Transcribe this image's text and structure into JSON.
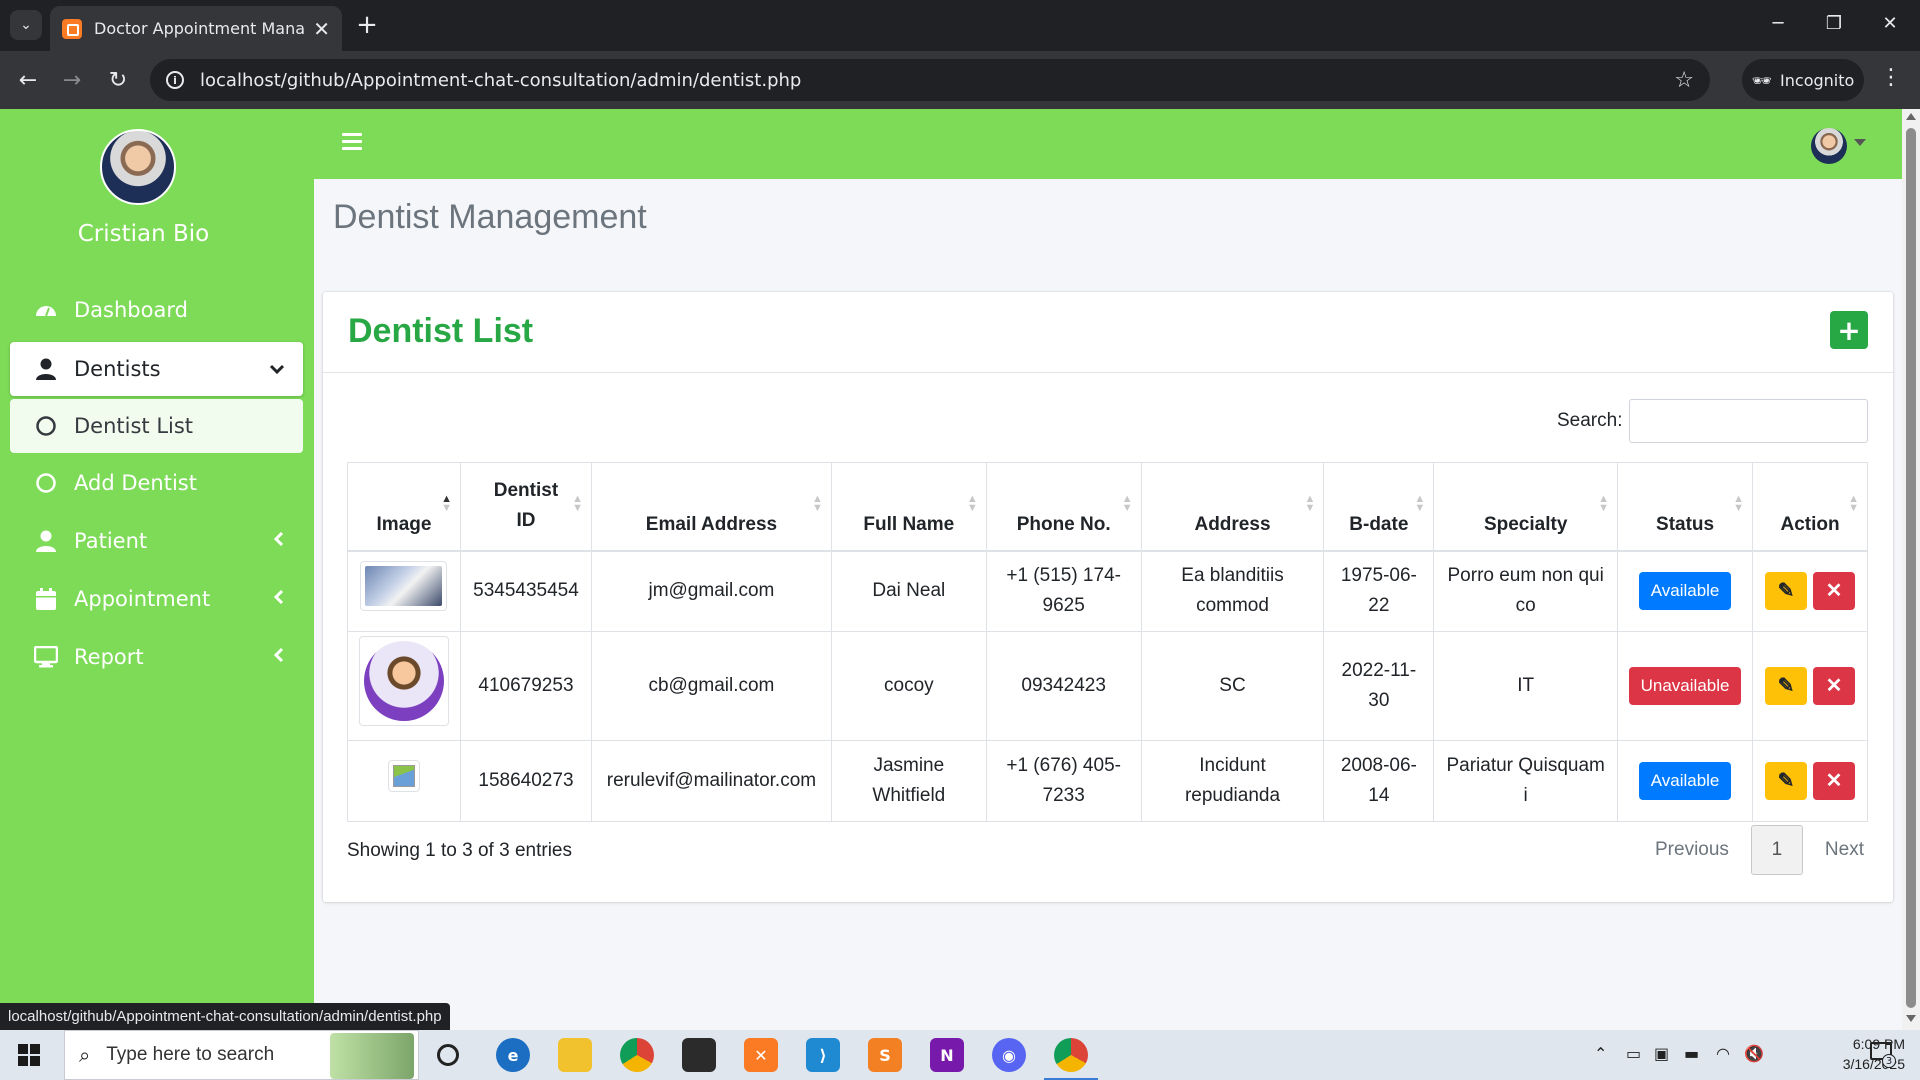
{
  "browser": {
    "tab_title": "Doctor Appointment Managem",
    "url": "localhost/github/Appointment-chat-consultation/admin/dentist.php",
    "incognito_label": "Incognito",
    "status_url": "localhost/github/Appointment-chat-consultation/admin/dentist.php"
  },
  "sidebar": {
    "user_name": "Cristian Bio",
    "items": [
      {
        "label": "Dashboard",
        "icon": "dashboard-icon"
      },
      {
        "label": "Dentists",
        "icon": "user-icon"
      },
      {
        "label": "Dentist List",
        "icon": "circle-icon"
      },
      {
        "label": "Add Dentist",
        "icon": "circle-icon"
      },
      {
        "label": "Patient",
        "icon": "user-icon"
      },
      {
        "label": "Appointment",
        "icon": "calendar-icon"
      },
      {
        "label": "Report",
        "icon": "monitor-icon"
      }
    ]
  },
  "page": {
    "title": "Dentist Management",
    "card_title": "Dentist List",
    "search_label": "Search:",
    "showing": "Showing 1 to 3 of 3 entries",
    "pager": {
      "previous": "Previous",
      "current": "1",
      "next": "Next"
    }
  },
  "table": {
    "headers": [
      "Image",
      "Dentist ID",
      "Email Address",
      "Full Name",
      "Phone No.",
      "Address",
      "B-date",
      "Specialty",
      "Status",
      "Action"
    ],
    "rows": [
      {
        "image": "photo-thumbnail",
        "id": "5345435454",
        "email": "jm@gmail.com",
        "name": "Dai Neal",
        "phone": "+1 (515) 174-9625",
        "address": "Ea blanditiis commod",
        "bdate": "1975-06-22",
        "specialty": "Porro eum non qui co",
        "status": "Available"
      },
      {
        "image": "avatar-thumbnail",
        "id": "410679253",
        "email": "cb@gmail.com",
        "name": "cocoy",
        "phone": "09342423",
        "address": "SC",
        "bdate": "2022-11-30",
        "specialty": "IT",
        "status": "Unavailable"
      },
      {
        "image": "broken-image",
        "id": "158640273",
        "email": "rerulevif@mailinator.com",
        "name": "Jasmine Whitfield",
        "phone": "+1 (676) 405-7233",
        "address": "Incidunt repudianda",
        "bdate": "2008-06-14",
        "specialty": "Pariatur Quisquam i",
        "status": "Available"
      }
    ]
  },
  "taskbar": {
    "search_placeholder": "Type here to search",
    "time": "6:09 PM",
    "date": "3/16/2025",
    "notification_count": "3"
  },
  "colors": {
    "sidebar": "#7ddb58",
    "accent_green": "#28a745",
    "available": "#007bff",
    "unavailable": "#dc3545",
    "edit": "#ffc107"
  }
}
